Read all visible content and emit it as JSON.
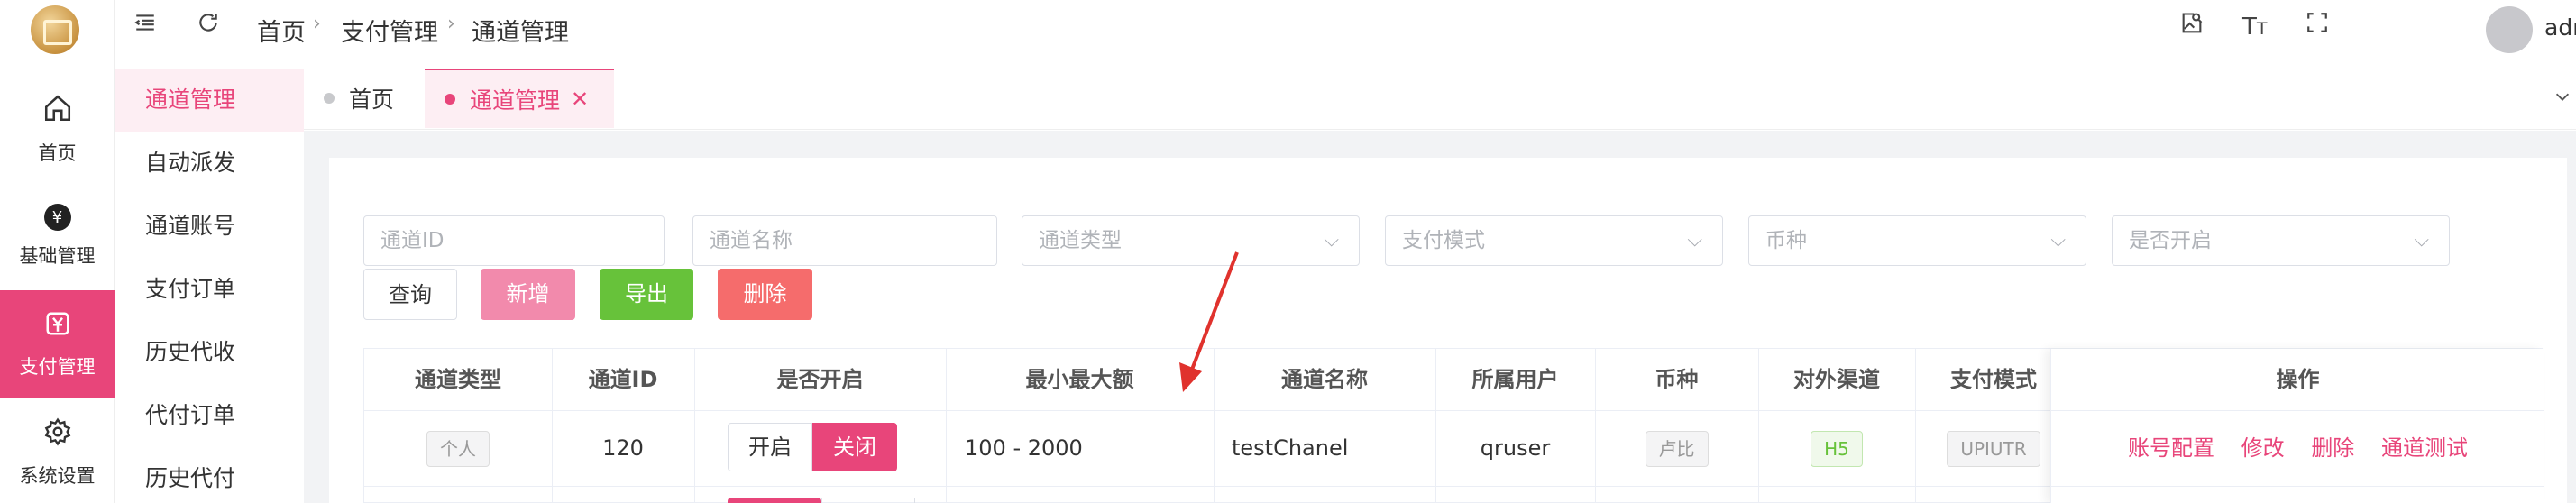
{
  "header": {
    "breadcrumb": [
      "首页",
      "支付管理",
      "通道管理"
    ],
    "user": "admin"
  },
  "rail": [
    {
      "label": "首页",
      "icon": "home-icon"
    },
    {
      "label": "基础管理",
      "icon": "yen-icon"
    },
    {
      "label": "支付管理",
      "icon": "payment-icon",
      "active": true
    },
    {
      "label": "系统设置",
      "icon": "gear-icon"
    }
  ],
  "submenu": [
    "通道管理",
    "自动派发",
    "通道账号",
    "支付订单",
    "历史代收",
    "代付订单",
    "历史代付"
  ],
  "tabs": [
    {
      "label": "首页",
      "active": false
    },
    {
      "label": "通道管理",
      "active": true
    }
  ],
  "filters": {
    "channel_id": "通道ID",
    "channel_name": "通道名称",
    "channel_type": "通道类型",
    "pay_mode": "支付模式",
    "currency": "币种",
    "enabled": "是否开启"
  },
  "buttons": {
    "query": "查询",
    "add": "新增",
    "export": "导出",
    "delete": "删除"
  },
  "table": {
    "columns": [
      "通道类型",
      "通道ID",
      "是否开启",
      "最小最大额",
      "通道名称",
      "所属用户",
      "币种",
      "对外渠道",
      "支付模式",
      "操作"
    ],
    "rows": [
      {
        "type": "个人",
        "id": "120",
        "toggle_on": "开启",
        "toggle_off": "关闭",
        "range": "100 - 2000",
        "name": "testChanel",
        "user": "qruser",
        "currency": "卢比",
        "outlet": "H5",
        "mode": "UPIUTR",
        "ops": [
          "账号配置",
          "修改",
          "删除",
          "通道测试"
        ]
      }
    ]
  },
  "colors": {
    "accent": "#e8457a",
    "green": "#67c23a",
    "red": "#f56c6c",
    "pink_button": "#f28aac"
  }
}
